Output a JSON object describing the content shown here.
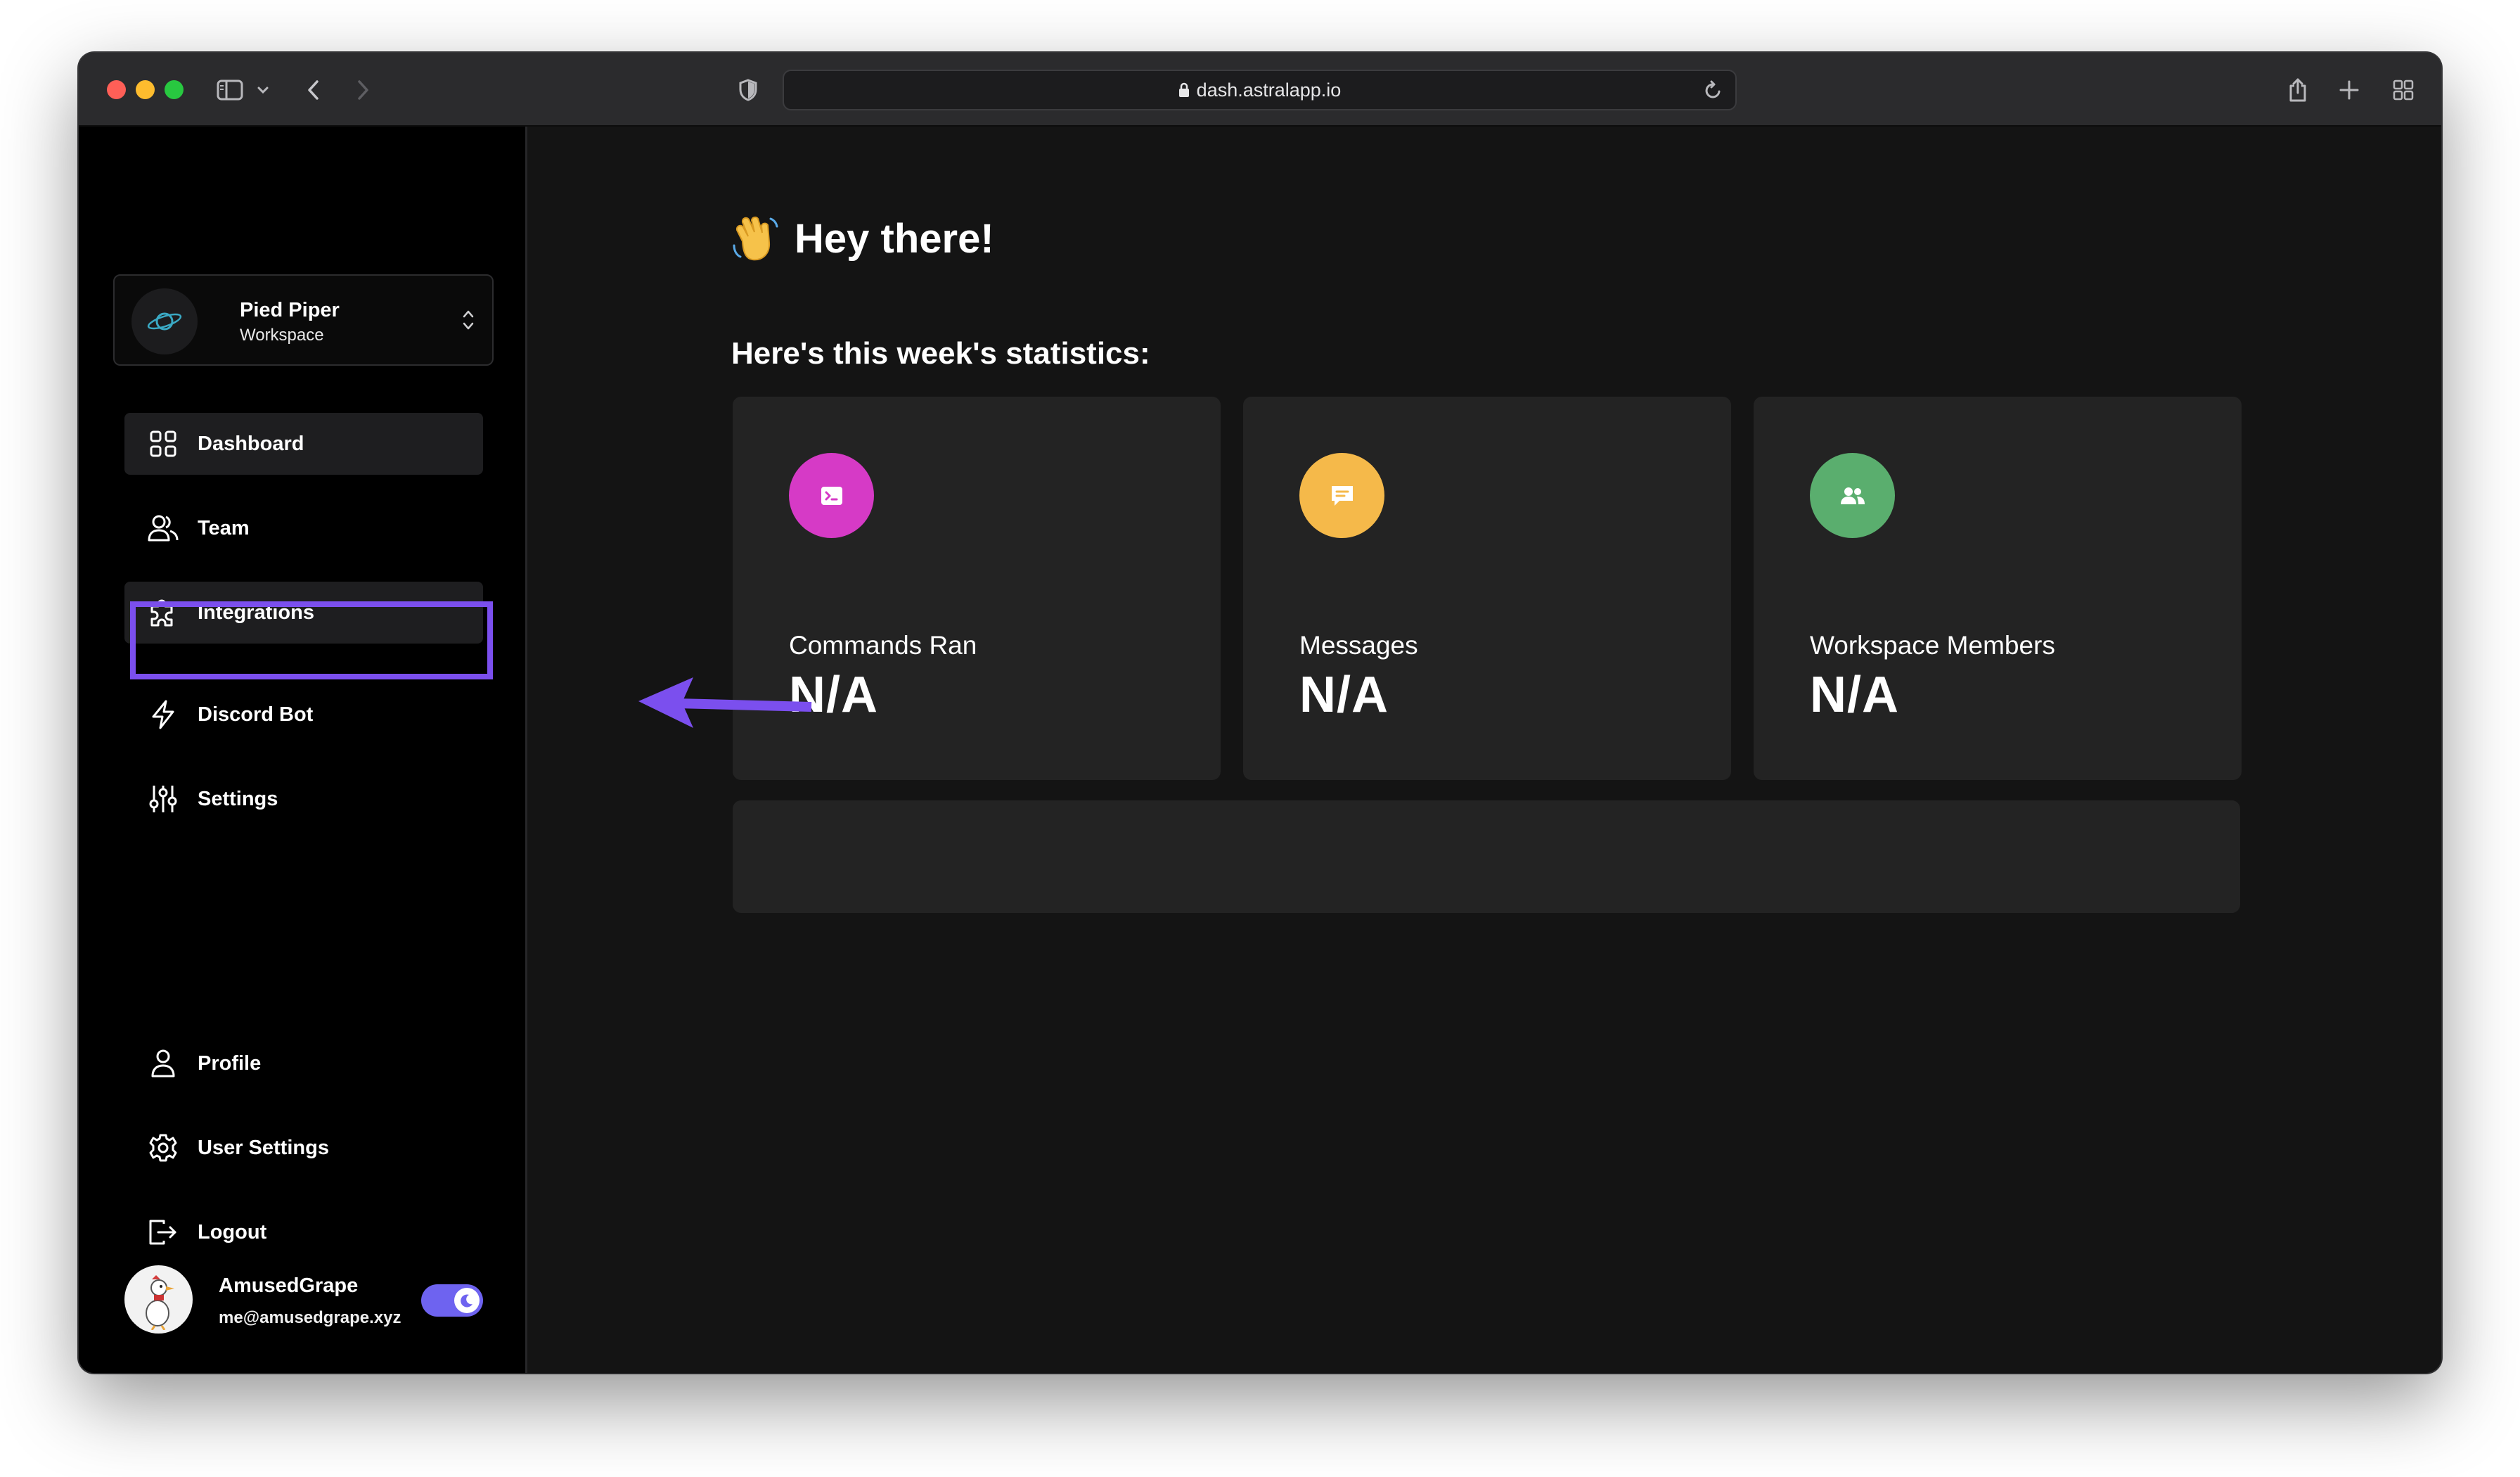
{
  "browser": {
    "url": "dash.astralapp.io"
  },
  "workspace": {
    "name": "Pied Piper",
    "subtitle": "Workspace"
  },
  "sidebar": {
    "items": [
      {
        "label": "Dashboard",
        "icon": "grid-icon",
        "active": true
      },
      {
        "label": "Team",
        "icon": "users-icon",
        "active": false
      },
      {
        "label": "Integrations",
        "icon": "puzzle-icon",
        "active": true
      },
      {
        "label": "Discord Bot",
        "icon": "lightning-icon",
        "active": false,
        "highlighted": true
      },
      {
        "label": "Settings",
        "icon": "sliders-icon",
        "active": false
      }
    ],
    "bottom_items": [
      {
        "label": "Profile",
        "icon": "user-icon"
      },
      {
        "label": "User Settings",
        "icon": "gear-icon"
      },
      {
        "label": "Logout",
        "icon": "logout-icon"
      }
    ]
  },
  "user": {
    "name": "AmusedGrape",
    "email": "me@amusedgrape.xyz",
    "dark_mode": true
  },
  "main": {
    "greeting": "Hey there!",
    "subheading": "Here's this week's statistics:",
    "stats": [
      {
        "label": "Commands Ran",
        "value": "N/A",
        "icon": "terminal-icon",
        "color": "#d63ac6"
      },
      {
        "label": "Messages",
        "value": "N/A",
        "icon": "message-icon",
        "color": "#f5b94a"
      },
      {
        "label": "Workspace Members",
        "value": "N/A",
        "icon": "members-icon",
        "color": "#5aae6e"
      }
    ]
  },
  "colors": {
    "accent": "#7b4fee",
    "toggle": "#6e63f0",
    "background": "#141414",
    "sidebar": "#000000",
    "card": "#232323"
  }
}
